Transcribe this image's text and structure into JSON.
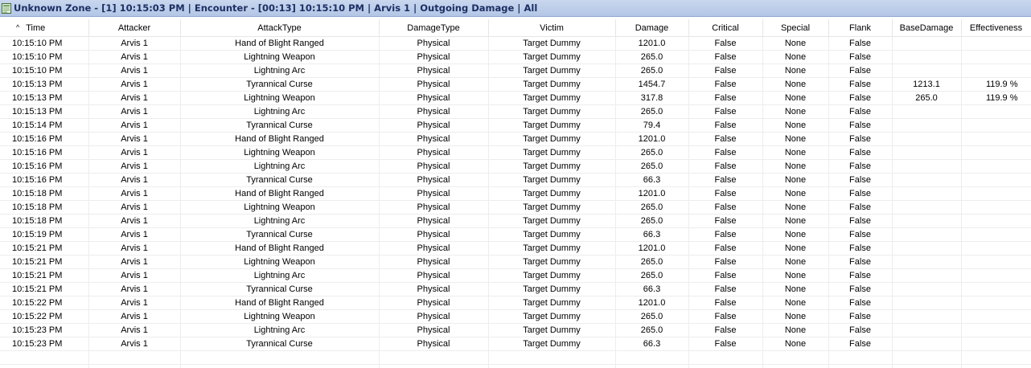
{
  "window": {
    "title": "Unknown Zone - [1] 10:15:03 PM | Encounter - [00:13] 10:15:10 PM | Arvis 1 | Outgoing Damage | All",
    "icon": "grid-view-icon"
  },
  "columns": [
    "Time",
    "Attacker",
    "AttackType",
    "DamageType",
    "Victim",
    "Damage",
    "Critical",
    "Special",
    "Flank",
    "BaseDamage",
    "Effectiveness"
  ],
  "sort": {
    "column": "Time",
    "direction": "ascending",
    "indicator": "^"
  },
  "rows": [
    [
      "10:15:10 PM",
      "Arvis 1",
      "Hand of Blight Ranged",
      "Physical",
      "Target Dummy",
      "1201.0",
      "False",
      "None",
      "False",
      "",
      ""
    ],
    [
      "10:15:10 PM",
      "Arvis 1",
      "Lightning Weapon",
      "Physical",
      "Target Dummy",
      "265.0",
      "False",
      "None",
      "False",
      "",
      ""
    ],
    [
      "10:15:10 PM",
      "Arvis 1",
      "Lightning Arc",
      "Physical",
      "Target Dummy",
      "265.0",
      "False",
      "None",
      "False",
      "",
      ""
    ],
    [
      "10:15:13 PM",
      "Arvis 1",
      "Tyrannical Curse",
      "Physical",
      "Target Dummy",
      "1454.7",
      "False",
      "None",
      "False",
      "1213.1",
      "119.9 %"
    ],
    [
      "10:15:13 PM",
      "Arvis 1",
      "Lightning Weapon",
      "Physical",
      "Target Dummy",
      "317.8",
      "False",
      "None",
      "False",
      "265.0",
      "119.9 %"
    ],
    [
      "10:15:13 PM",
      "Arvis 1",
      "Lightning Arc",
      "Physical",
      "Target Dummy",
      "265.0",
      "False",
      "None",
      "False",
      "",
      ""
    ],
    [
      "10:15:14 PM",
      "Arvis 1",
      "Tyrannical Curse",
      "Physical",
      "Target Dummy",
      "79.4",
      "False",
      "None",
      "False",
      "",
      ""
    ],
    [
      "10:15:16 PM",
      "Arvis 1",
      "Hand of Blight Ranged",
      "Physical",
      "Target Dummy",
      "1201.0",
      "False",
      "None",
      "False",
      "",
      ""
    ],
    [
      "10:15:16 PM",
      "Arvis 1",
      "Lightning Weapon",
      "Physical",
      "Target Dummy",
      "265.0",
      "False",
      "None",
      "False",
      "",
      ""
    ],
    [
      "10:15:16 PM",
      "Arvis 1",
      "Lightning Arc",
      "Physical",
      "Target Dummy",
      "265.0",
      "False",
      "None",
      "False",
      "",
      ""
    ],
    [
      "10:15:16 PM",
      "Arvis 1",
      "Tyrannical Curse",
      "Physical",
      "Target Dummy",
      "66.3",
      "False",
      "None",
      "False",
      "",
      ""
    ],
    [
      "10:15:18 PM",
      "Arvis 1",
      "Hand of Blight Ranged",
      "Physical",
      "Target Dummy",
      "1201.0",
      "False",
      "None",
      "False",
      "",
      ""
    ],
    [
      "10:15:18 PM",
      "Arvis 1",
      "Lightning Weapon",
      "Physical",
      "Target Dummy",
      "265.0",
      "False",
      "None",
      "False",
      "",
      ""
    ],
    [
      "10:15:18 PM",
      "Arvis 1",
      "Lightning Arc",
      "Physical",
      "Target Dummy",
      "265.0",
      "False",
      "None",
      "False",
      "",
      ""
    ],
    [
      "10:15:19 PM",
      "Arvis 1",
      "Tyrannical Curse",
      "Physical",
      "Target Dummy",
      "66.3",
      "False",
      "None",
      "False",
      "",
      ""
    ],
    [
      "10:15:21 PM",
      "Arvis 1",
      "Hand of Blight Ranged",
      "Physical",
      "Target Dummy",
      "1201.0",
      "False",
      "None",
      "False",
      "",
      ""
    ],
    [
      "10:15:21 PM",
      "Arvis 1",
      "Lightning Weapon",
      "Physical",
      "Target Dummy",
      "265.0",
      "False",
      "None",
      "False",
      "",
      ""
    ],
    [
      "10:15:21 PM",
      "Arvis 1",
      "Lightning Arc",
      "Physical",
      "Target Dummy",
      "265.0",
      "False",
      "None",
      "False",
      "",
      ""
    ],
    [
      "10:15:21 PM",
      "Arvis 1",
      "Tyrannical Curse",
      "Physical",
      "Target Dummy",
      "66.3",
      "False",
      "None",
      "False",
      "",
      ""
    ],
    [
      "10:15:22 PM",
      "Arvis 1",
      "Hand of Blight Ranged",
      "Physical",
      "Target Dummy",
      "1201.0",
      "False",
      "None",
      "False",
      "",
      ""
    ],
    [
      "10:15:22 PM",
      "Arvis 1",
      "Lightning Weapon",
      "Physical",
      "Target Dummy",
      "265.0",
      "False",
      "None",
      "False",
      "",
      ""
    ],
    [
      "10:15:23 PM",
      "Arvis 1",
      "Lightning Arc",
      "Physical",
      "Target Dummy",
      "265.0",
      "False",
      "None",
      "False",
      "",
      ""
    ],
    [
      "10:15:23 PM",
      "Arvis 1",
      "Tyrannical Curse",
      "Physical",
      "Target Dummy",
      "66.3",
      "False",
      "None",
      "False",
      "",
      ""
    ]
  ],
  "colors": {
    "title_bar": "#b3c6e6",
    "title_text": "#1c2f63",
    "grid_line": "#ededed"
  }
}
